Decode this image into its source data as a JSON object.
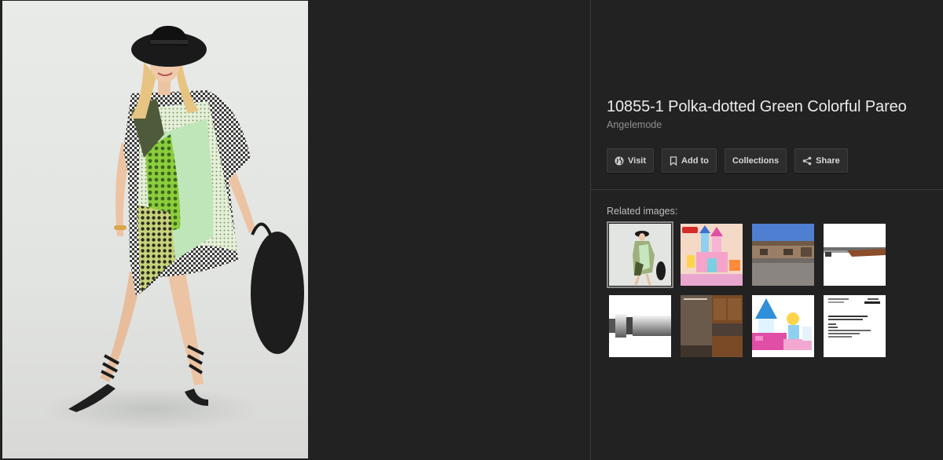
{
  "image": {
    "title": "10855-1 Polka-dotted Green Colorful Pareo",
    "source": "Angelemode"
  },
  "actions": [
    {
      "label": "Visit",
      "icon": "globe-icon"
    },
    {
      "label": "Add to",
      "icon": "bookmark-icon"
    },
    {
      "label": "Collections",
      "icon": ""
    },
    {
      "label": "Share",
      "icon": "share-icon"
    }
  ],
  "related": {
    "label": "Related images:",
    "thumbnails": [
      {
        "name": "related-thumb-pareo-model",
        "selected": true
      },
      {
        "name": "related-thumb-duplo-castle-box",
        "selected": false
      },
      {
        "name": "related-thumb-ranch-house",
        "selected": false
      },
      {
        "name": "related-thumb-shotgun",
        "selected": false
      },
      {
        "name": "related-thumb-metal-shaft",
        "selected": false
      },
      {
        "name": "related-thumb-empty-room",
        "selected": false
      },
      {
        "name": "related-thumb-duplo-princess-set",
        "selected": false
      },
      {
        "name": "related-thumb-standard-document",
        "selected": false
      }
    ]
  },
  "colors": {
    "background": "#222222",
    "divider": "#3a3a3a",
    "title": "#ececec",
    "muted": "#8f8f8f"
  }
}
